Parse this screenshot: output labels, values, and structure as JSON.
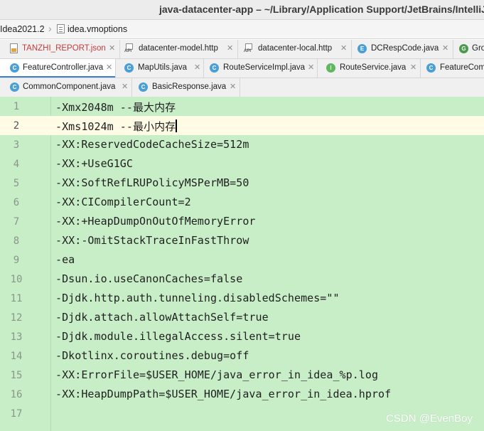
{
  "window": {
    "title": "java-datacenter-app – ~/Library/Application Support/JetBrains/IntelliJ"
  },
  "breadcrumb": {
    "root": "Idea2021.2",
    "file": "idea.vmoptions"
  },
  "tabs_row1": [
    {
      "label": "TANZHI_REPORT.json",
      "icon": "json-file-icon"
    },
    {
      "label": "datacenter-model.http",
      "icon": "api-file-icon"
    },
    {
      "label": "datacenter-local.http",
      "icon": "api-file-icon"
    },
    {
      "label": "DCRespCode.java",
      "icon": "enum-class-icon"
    },
    {
      "label": "Gro",
      "icon": "groovy-class-icon"
    }
  ],
  "tabs_row2": [
    {
      "label": "FeatureController.java",
      "icon": "class-icon"
    },
    {
      "label": "MapUtils.java",
      "icon": "class-icon"
    },
    {
      "label": "RouteServiceImpl.java",
      "icon": "class-icon"
    },
    {
      "label": "RouteService.java",
      "icon": "interface-icon"
    },
    {
      "label": "FeatureCom",
      "icon": "class-icon"
    }
  ],
  "tabs_row3": [
    {
      "label": "CommonComponent.java",
      "icon": "class-icon"
    },
    {
      "label": "BasicResponse.java",
      "icon": "class-icon"
    }
  ],
  "editor": {
    "current_line": 2,
    "lines": [
      {
        "n": "1",
        "text": "-Xmx2048m --最大内存"
      },
      {
        "n": "2",
        "text": "-Xms1024m --最小内存"
      },
      {
        "n": "3",
        "text": "-XX:ReservedCodeCacheSize=512m"
      },
      {
        "n": "4",
        "text": "-XX:+UseG1GC"
      },
      {
        "n": "5",
        "text": "-XX:SoftRefLRUPolicyMSPerMB=50"
      },
      {
        "n": "6",
        "text": "-XX:CICompilerCount=2"
      },
      {
        "n": "7",
        "text": "-XX:+HeapDumpOnOutOfMemoryError"
      },
      {
        "n": "8",
        "text": "-XX:-OmitStackTraceInFastThrow"
      },
      {
        "n": "9",
        "text": "-ea"
      },
      {
        "n": "10",
        "text": "-Dsun.io.useCanonCaches=false"
      },
      {
        "n": "11",
        "text": "-Djdk.http.auth.tunneling.disabledSchemes=\"\""
      },
      {
        "n": "12",
        "text": "-Djdk.attach.allowAttachSelf=true"
      },
      {
        "n": "13",
        "text": "-Djdk.module.illegalAccess.silent=true"
      },
      {
        "n": "14",
        "text": "-Dkotlinx.coroutines.debug=off"
      },
      {
        "n": "15",
        "text": "-XX:ErrorFile=$USER_HOME/java_error_in_idea_%p.log"
      },
      {
        "n": "16",
        "text": "-XX:HeapDumpPath=$USER_HOME/java_error_in_idea.hprof"
      },
      {
        "n": "17",
        "text": ""
      }
    ]
  },
  "watermark": "CSDN @EvenBoy",
  "colors": {
    "editor_bg": "#c7eec7",
    "current_line_bg": "#fffbe4",
    "tab_accent": "#4083c9"
  }
}
